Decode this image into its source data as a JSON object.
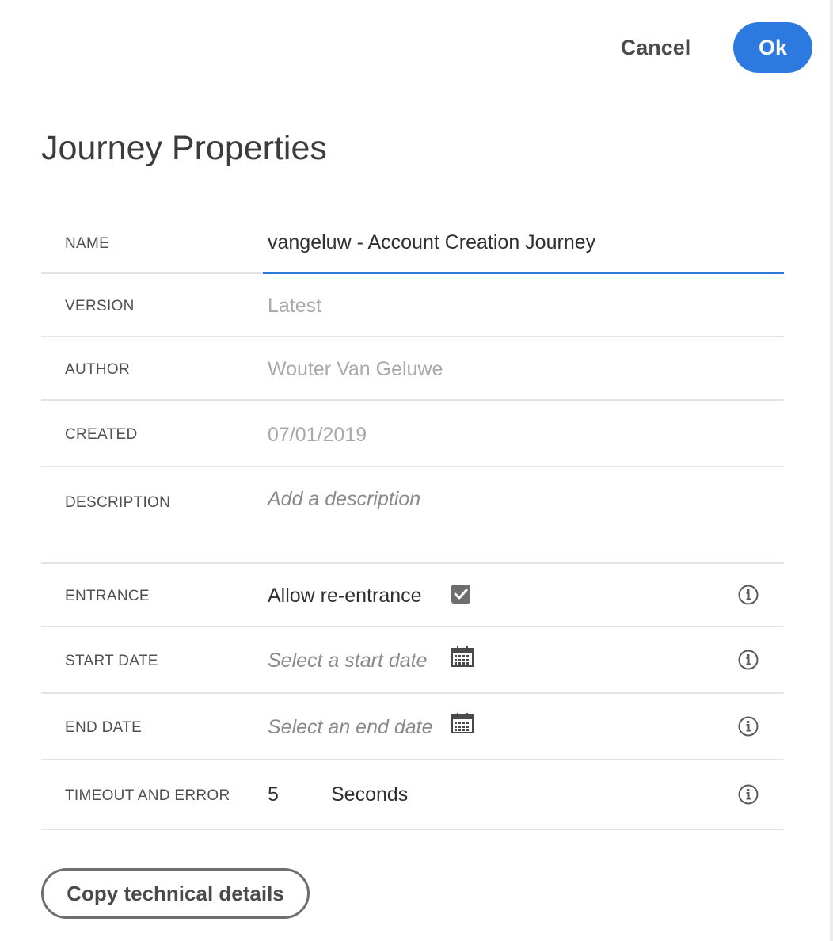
{
  "toolbar": {
    "cancel_label": "Cancel",
    "ok_label": "Ok",
    "accent_color": "#2c79e0"
  },
  "page": {
    "title": "Journey Properties"
  },
  "fields": {
    "name": {
      "label": "NAME",
      "value": "vangeluw - Account Creation Journey"
    },
    "version": {
      "label": "VERSION",
      "value": "Latest"
    },
    "author": {
      "label": "AUTHOR",
      "value": "Wouter Van Geluwe"
    },
    "created": {
      "label": "CREATED",
      "value": "07/01/2019"
    },
    "description": {
      "label": "DESCRIPTION",
      "placeholder": "Add a description"
    },
    "entrance": {
      "label": "ENTRANCE",
      "option_label": "Allow re-entrance",
      "checked": true,
      "info_icon": "info-icon"
    },
    "start_date": {
      "label": "START DATE",
      "placeholder": "Select a start date",
      "icon": "calendar-icon",
      "info_icon": "info-icon"
    },
    "end_date": {
      "label": "END DATE",
      "placeholder": "Select an end date",
      "icon": "calendar-icon",
      "info_icon": "info-icon"
    },
    "timeout": {
      "label": "TIMEOUT AND ERROR",
      "value": "5",
      "unit": "Seconds",
      "info_icon": "info-icon"
    }
  },
  "footer": {
    "copy_button_label": "Copy technical details"
  }
}
